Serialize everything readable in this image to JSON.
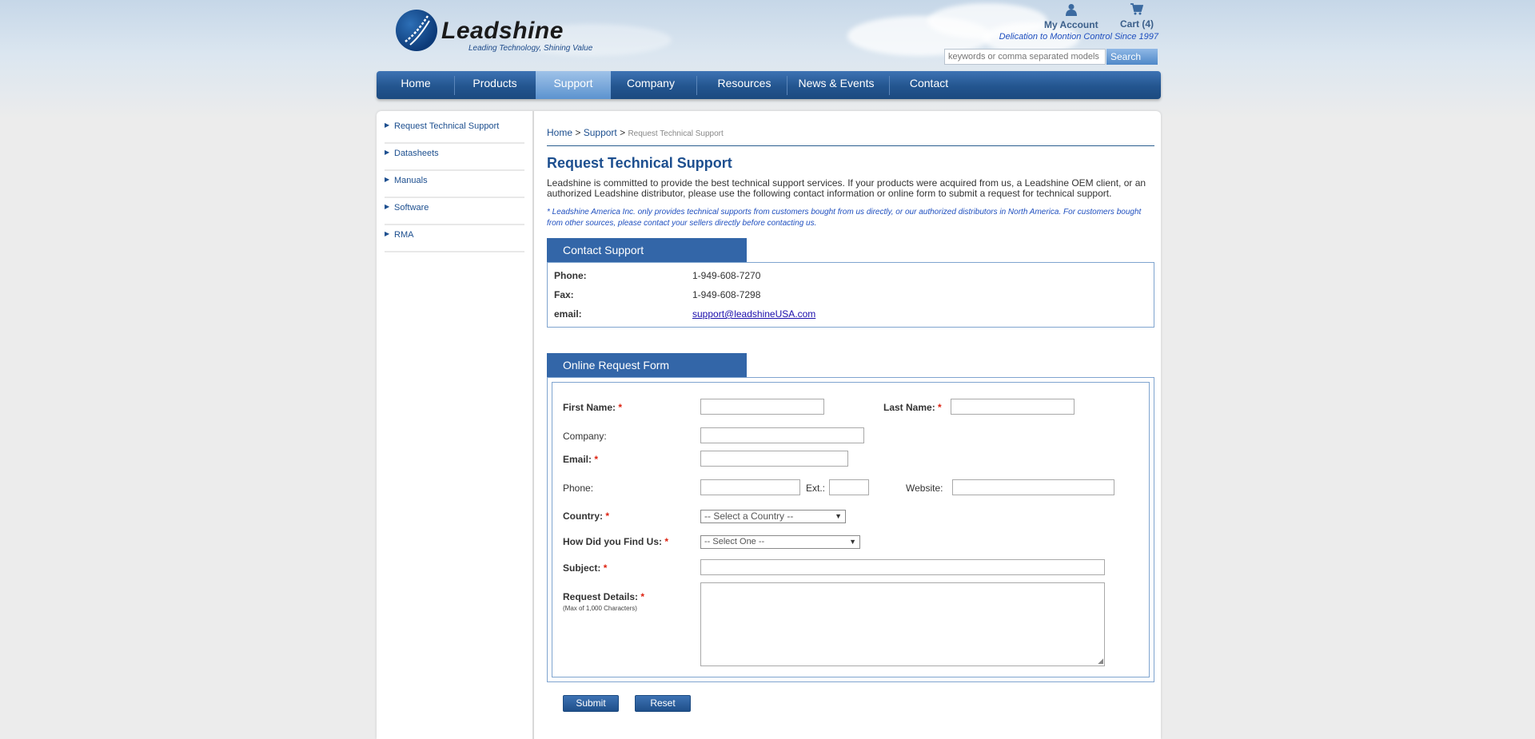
{
  "header": {
    "logo_text": "Leadshine",
    "tagline": "Leading Technology, Shining Value",
    "my_account": "My Account",
    "cart": "Cart (4)",
    "slogan": "Delication to Montion Control Since 1997",
    "search_placeholder": "keywords or comma separated models",
    "search_button": "Search"
  },
  "nav": {
    "items": [
      "Home",
      "Products",
      "Support",
      "Company",
      "Resources",
      "News & Events",
      "Contact"
    ],
    "active": "Support"
  },
  "sidebar": {
    "items": [
      "Request Technical Support",
      "Datasheets",
      "Manuals",
      "Software",
      "RMA"
    ]
  },
  "breadcrumb": {
    "home": "Home",
    "sep": ">",
    "support": "Support",
    "current": "Request Technical Support"
  },
  "page": {
    "title": "Request Technical Support",
    "intro": "Leadshine is committed to provide the best technical support services. If your products were acquired from us, a Leadshine OEM client, or an authorized Leadshine distributor, please use the following contact information or online form to submit a request for technical support.",
    "note": "* Leadshine America Inc. only provides technical supports from customers bought from us directly, or our authorized distributors in North America. For customers bought from other sources, please contact your sellers directly before contacting us."
  },
  "contact": {
    "heading": "Contact Support",
    "phone_label": "Phone:",
    "phone": "1-949-608-7270",
    "fax_label": "Fax:",
    "fax": "1-949-608-7298",
    "email_label": "email:",
    "email": "support@leadshineUSA.com"
  },
  "form": {
    "heading": "Online Request Form",
    "required_mark": "*",
    "first_name": "First Name:",
    "last_name": "Last Name:",
    "company": "Company:",
    "email": "Email:",
    "phone": "Phone:",
    "ext": "Ext.:",
    "website": "Website:",
    "country": "Country:",
    "country_select": "-- Select a Country --",
    "find_us": "How Did you Find Us:",
    "find_us_select": "-- Select One --",
    "subject": "Subject:",
    "details": "Request Details:",
    "details_note": "(Max of 1,000 Characters)",
    "submit": "Submit",
    "reset": "Reset"
  },
  "colors": {
    "brand": "#1d4f8f",
    "nav": "#23558f",
    "required": "#dd1111",
    "note": "#1f4fbf"
  }
}
